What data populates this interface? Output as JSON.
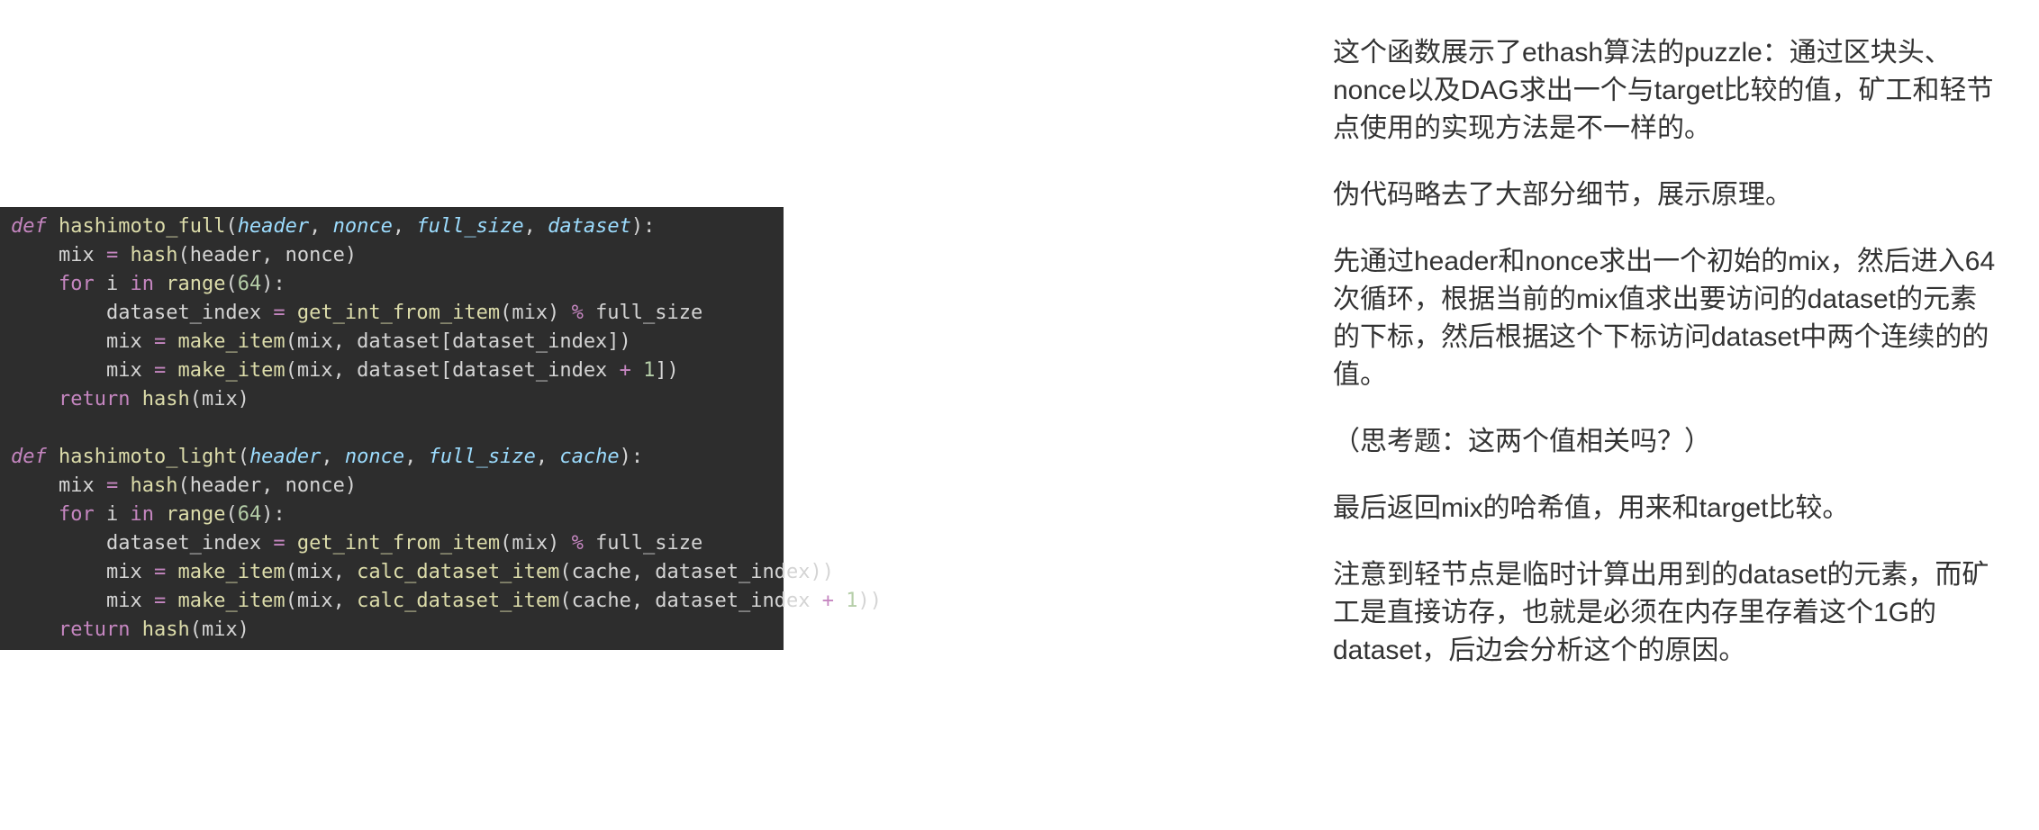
{
  "code": {
    "func1": {
      "name": "hashimoto_full",
      "param1": "header",
      "param2": "nonce",
      "param3": "full_size",
      "param4": "dataset",
      "l1_mix": "mix",
      "l1_hash": "hash",
      "l1_args": "(header, nonce)",
      "l2_for": "for",
      "l2_i": "i",
      "l2_in": "in",
      "l2_range": "range",
      "l2_num": "64",
      "l3_di": "dataset_index",
      "l3_get": "get_int_from_item",
      "l3_arg": "(mix)",
      "l3_mod": "%",
      "l3_fs": "full_size",
      "l4_mix": "mix",
      "l4_make": "make_item",
      "l4_args": "(mix, dataset[dataset_index])",
      "l5_mix": "mix",
      "l5_make": "make_item",
      "l5_args_open": "(mix, dataset[dataset_index ",
      "l5_plus": "+",
      "l5_one": "1",
      "l5_args_close": "])",
      "l6_return": "return",
      "l6_hash": "hash",
      "l6_args": "(mix)"
    },
    "func2": {
      "name": "hashimoto_light",
      "param1": "header",
      "param2": "nonce",
      "param3": "full_size",
      "param4": "cache",
      "l1_mix": "mix",
      "l1_hash": "hash",
      "l1_args": "(header, nonce)",
      "l2_for": "for",
      "l2_i": "i",
      "l2_in": "in",
      "l2_range": "range",
      "l2_num": "64",
      "l3_di": "dataset_index",
      "l3_get": "get_int_from_item",
      "l3_arg": "(mix)",
      "l3_mod": "%",
      "l3_fs": "full_size",
      "l4_mix": "mix",
      "l4_make": "make_item",
      "l4_arg_open": "(mix, ",
      "l4_calc": "calc_dataset_item",
      "l4_calc_args": "(cache, dataset_index))",
      "l5_mix": "mix",
      "l5_make": "make_item",
      "l5_arg_open": "(mix, ",
      "l5_calc": "calc_dataset_item",
      "l5_calc_args_open": "(cache, dataset_index ",
      "l5_plus": "+",
      "l5_one": "1",
      "l5_calc_args_close": "))",
      "l6_return": "return",
      "l6_hash": "hash",
      "l6_args": "(mix)"
    },
    "kw_def": "def"
  },
  "explain": {
    "p1": "这个函数展示了ethash算法的puzzle：通过区块头、nonce以及DAG求出一个与target比较的值，矿工和轻节点使用的实现方法是不一样的。",
    "p2": "伪代码略去了大部分细节，展示原理。",
    "p3": "先通过header和nonce求出一个初始的mix，然后进入64次循环，根据当前的mix值求出要访问的dataset的元素的下标，然后根据这个下标访问dataset中两个连续的的值。",
    "p4": "（思考题：这两个值相关吗？）",
    "p5": "最后返回mix的哈希值，用来和target比较。",
    "p6": "注意到轻节点是临时计算出用到的dataset的元素，而矿工是直接访存，也就是必须在内存里存着这个1G的dataset，后边会分析这个的原因。"
  }
}
